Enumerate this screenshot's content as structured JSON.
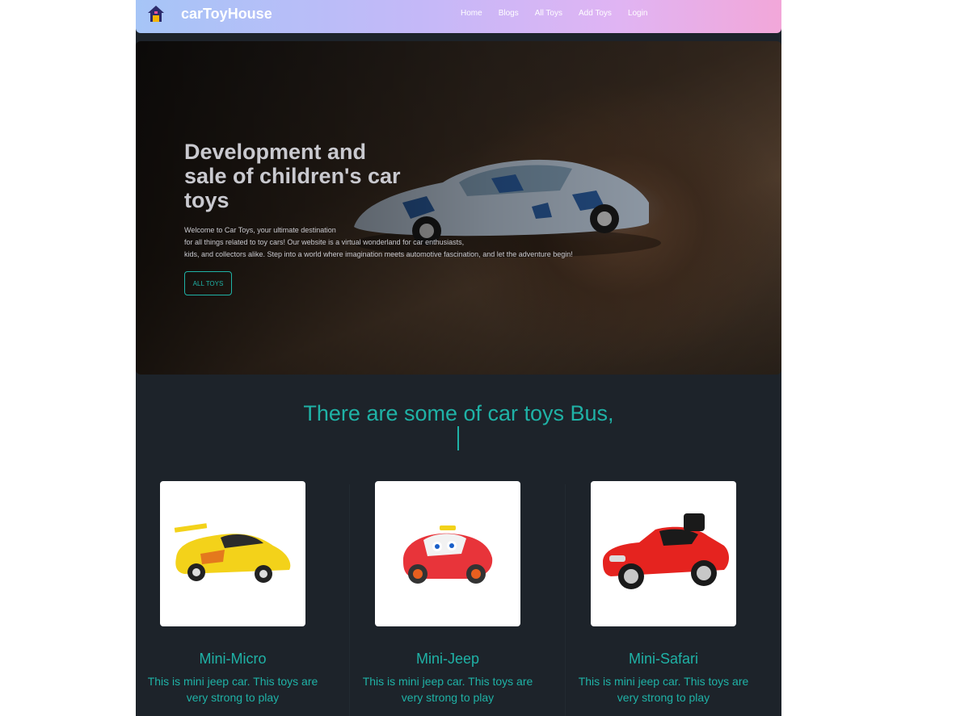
{
  "navbar": {
    "brand": "carToyHouse",
    "links": [
      "Home",
      "Blogs",
      "All Toys",
      "Add Toys",
      "Login"
    ]
  },
  "hero": {
    "title": "Development and sale of children's car toys",
    "description": [
      "Welcome to Car Toys, your ultimate destination",
      "for all things related to toy cars! Our website is a virtual wonderland for car enthusiasts,",
      "kids, and collectors alike. Step into a world where imagination meets automotive fascination, and let the adventure begin!"
    ],
    "button": "ALL TOYS"
  },
  "section": {
    "title": "There are some of car toys Bus,"
  },
  "cards": [
    {
      "title": "Mini-Micro",
      "desc": "This is mini jeep car. This toys are very strong to play",
      "car_color": "#f3d21a"
    },
    {
      "title": "Mini-Jeep",
      "desc": "This is mini jeep car. This toys are very strong to play",
      "car_color": "#e8343a"
    },
    {
      "title": "Mini-Safari",
      "desc": "This is mini jeep car. This toys are very strong to play",
      "car_color": "#e5231f"
    }
  ],
  "colors": {
    "accent": "#1fb2a6",
    "background": "#1d232a"
  }
}
